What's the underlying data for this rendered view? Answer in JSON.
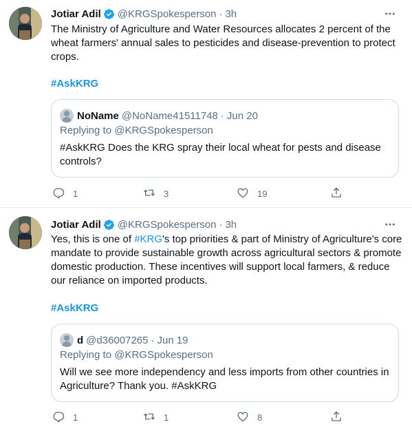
{
  "tweets": [
    {
      "author_name": "Jotiar Adil",
      "handle": "@KRGSpokesperson",
      "separator": "·",
      "time": "3h",
      "text": "The Ministry of Agriculture and Water Resources allocates 2 percent of the wheat farmers' annual sales to pesticides and disease-prevention to protect crops.",
      "hashtag": "#AskKRG",
      "quoted": {
        "author_name": "NoName",
        "handle": "@NoName41511748",
        "separator": "·",
        "date": "Jun 20",
        "replying_to": "Replying to @KRGSpokesperson",
        "text": "#AskKRG Does the KRG spray their local wheat for pests and disease controls?"
      },
      "replies": "1",
      "retweets": "3",
      "likes": "19"
    },
    {
      "author_name": "Jotiar Adil",
      "handle": "@KRGSpokesperson",
      "separator": "·",
      "time": "3h",
      "text_before_link": "Yes, this is one of ",
      "text_link": "#KRG",
      "text_after_link": "'s top priorities & part of Ministry of Agriculture's core mandate to provide sustainable growth across agricultural sectors & promote domestic production. These incentives will support local farmers, & reduce our reliance on imported products.",
      "hashtag": "#AskKRG",
      "quoted": {
        "author_name": "d",
        "handle": "@d36007265",
        "separator": "·",
        "date": "Jun 19",
        "replying_to": "Replying to @KRGSpokesperson",
        "text": "Will we see more independency and less imports from other countries in Agriculture? Thank you. #AskKRG"
      },
      "replies": "1",
      "retweets": "1",
      "likes": "8"
    }
  ],
  "icons": {
    "verified": "verified-badge-icon",
    "more": "more-options-icon",
    "reply": "reply-icon",
    "retweet": "retweet-icon",
    "like": "heart-icon",
    "share": "share-icon"
  },
  "colors": {
    "accent": "#1b95e0",
    "secondary_text": "#5b7083",
    "border": "#cfd9de"
  }
}
